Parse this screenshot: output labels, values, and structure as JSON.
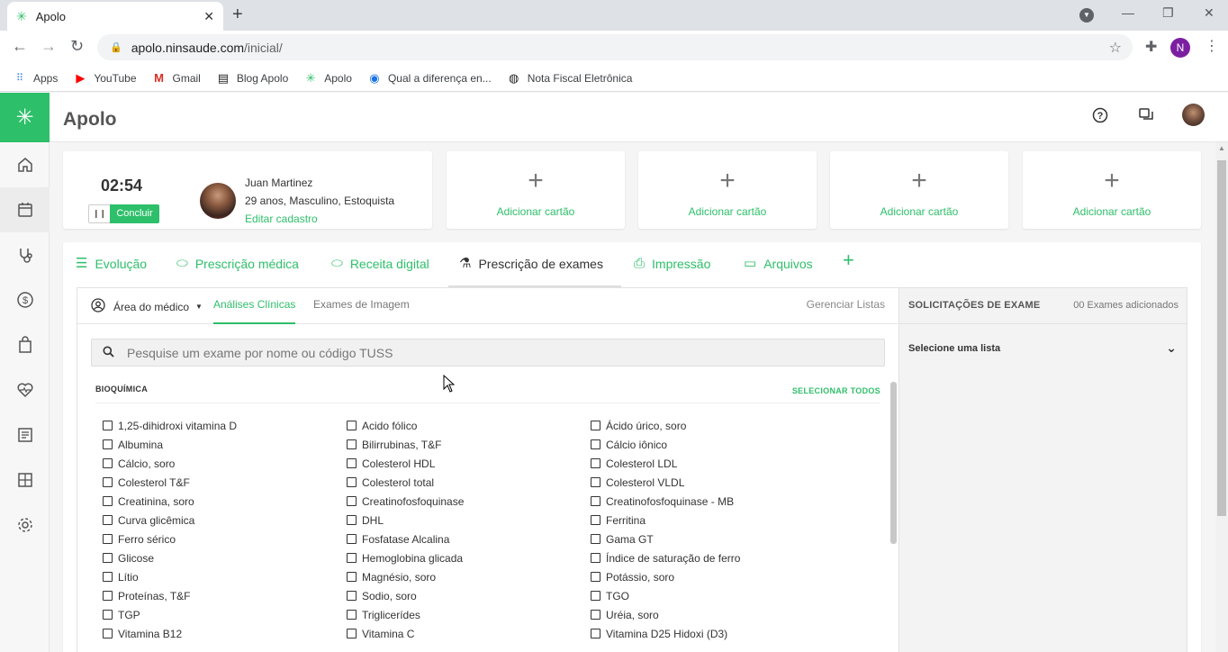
{
  "browser": {
    "tab_title": "Apolo",
    "tab_close": "✕",
    "new_tab": "+",
    "url_host": "apolo.ninsaude.com",
    "url_path": "/inicial/",
    "profile_initial": "N",
    "bookmarks": [
      {
        "label": "Apps",
        "icon": "apps-grid-icon"
      },
      {
        "label": "YouTube",
        "icon": "youtube-icon"
      },
      {
        "label": "Gmail",
        "icon": "gmail-icon"
      },
      {
        "label": "Blog Apolo",
        "icon": "blog-icon"
      },
      {
        "label": "Apolo",
        "icon": "apolo-icon"
      },
      {
        "label": "Qual a diferença en...",
        "icon": "link-icon"
      },
      {
        "label": "Nota Fiscal Eletrônica",
        "icon": "globe-icon"
      }
    ]
  },
  "app": {
    "title": "Apolo",
    "colors": {
      "accent": "#2ebf6a",
      "text": "#333333",
      "muted": "#777777"
    }
  },
  "timer": {
    "value": "02:54",
    "pause_label": "❙❙",
    "conclude_label": "Concluir"
  },
  "patient": {
    "name": "Juan Martinez",
    "info": "29 anos, Masculino, Estoquista",
    "edit_label": "Editar cadastro"
  },
  "add_cards": [
    {
      "label": "Adicionar cartão"
    },
    {
      "label": "Adicionar cartão"
    },
    {
      "label": "Adicionar cartão"
    },
    {
      "label": "Adicionar cartão"
    }
  ],
  "main_tabs": [
    {
      "label": "Evolução",
      "icon": "list-icon",
      "active": false
    },
    {
      "label": "Prescrição médica",
      "icon": "pill-icon",
      "active": false
    },
    {
      "label": "Receita digital",
      "icon": "pill-icon",
      "active": false
    },
    {
      "label": "Prescrição de exames",
      "icon": "flask-icon",
      "active": true
    },
    {
      "label": "Impressão",
      "icon": "printer-icon",
      "active": false
    },
    {
      "label": "Arquivos",
      "icon": "folder-icon",
      "active": false
    }
  ],
  "exams": {
    "area_label": "Área do médico",
    "sub_tabs": [
      {
        "label": "Análises Clínicas",
        "active": true
      },
      {
        "label": "Exames de Imagem",
        "active": false
      }
    ],
    "manage_lists": "Gerenciar Listas",
    "search_placeholder": "Pesquise um exame por nome ou código TUSS",
    "section_title": "BIOQUÍMICA",
    "select_all": "SELECIONAR TODOS",
    "columns": [
      [
        "1,25-dihidroxi vitamina D",
        "Albumina",
        "Cálcio, soro",
        "Colesterol T&F",
        "Creatinina, soro",
        "Curva glicêmica",
        "Ferro sérico",
        "Glicose",
        "Lítio",
        "Proteínas, T&F",
        "TGP",
        "Vitamina B12"
      ],
      [
        "Acido fólico",
        "Bilirrubinas, T&F",
        "Colesterol HDL",
        "Colesterol total",
        "Creatinofosfoquinase",
        "DHL",
        "Fosfatase Alcalina",
        "Hemoglobina glicada",
        "Magnésio, soro",
        "Sodio, soro",
        "Triglicerídes",
        "Vitamina C"
      ],
      [
        "Ácido úrico, soro",
        "Cálcio iônico",
        "Colesterol LDL",
        "Colesterol VLDL",
        "Creatinofosfoquinase - MB",
        "Ferritina",
        "Gama GT",
        "Índice de saturação de ferro",
        "Potássio, soro",
        "TGO",
        "Uréia, soro",
        "Vitamina D25 Hidoxi (D3)"
      ]
    ]
  },
  "requests": {
    "title": "SOLICITAÇÕES DE EXAME",
    "count": "00 Exames adicionados",
    "select_list": "Selecione uma lista"
  }
}
